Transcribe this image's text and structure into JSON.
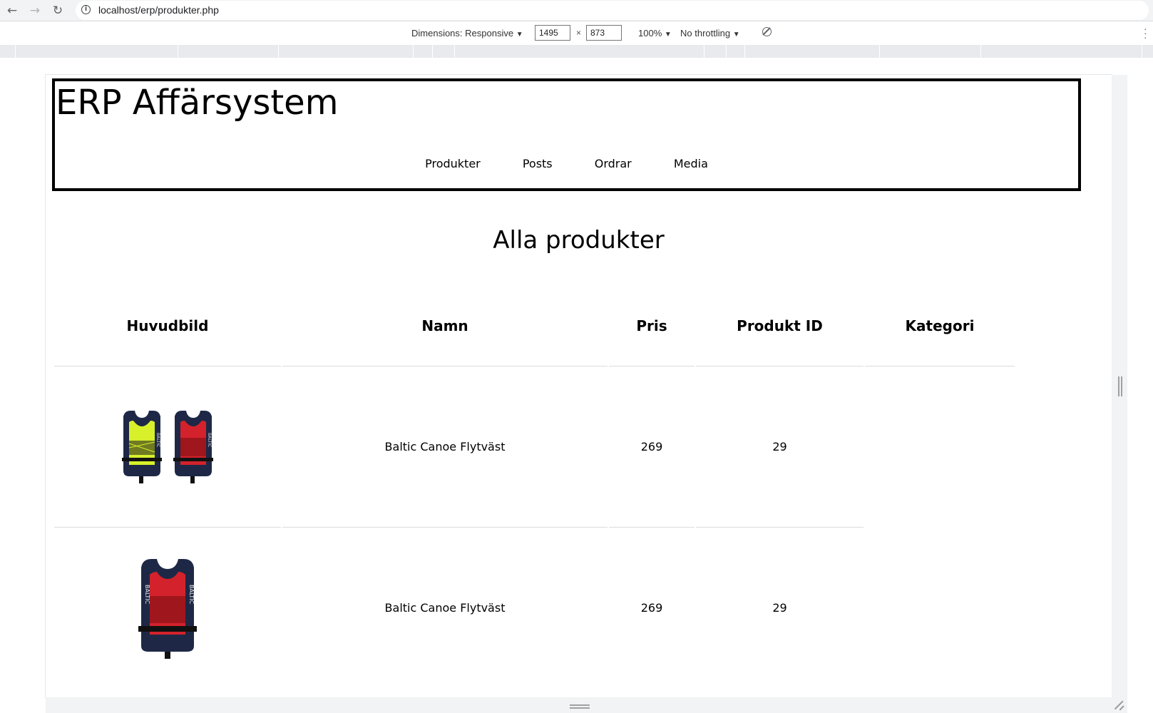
{
  "browser": {
    "url": "localhost/erp/produkter.php",
    "back_icon": "arrow-left-icon",
    "forward_icon": "arrow-right-icon",
    "reload_icon": "reload-icon"
  },
  "devtools": {
    "dimensions_label": "Dimensions: Responsive",
    "width": "1495",
    "separator": "×",
    "height": "873",
    "zoom": "100%",
    "throttling": "No throttling"
  },
  "site": {
    "title": "ERP Affärsystem",
    "nav": [
      "Produkter",
      "Posts",
      "Ordrar",
      "Media"
    ]
  },
  "main": {
    "heading": "Alla produkter",
    "table": {
      "headers": [
        "Huvudbild",
        "Namn",
        "Pris",
        "Produkt ID",
        "Kategori"
      ],
      "rows": [
        {
          "image": "two-life-vests-yellow-red",
          "name": "Baltic Canoe Flytväst",
          "price": "269",
          "id": "29",
          "category": ""
        },
        {
          "image": "life-vest-red",
          "name": "Baltic Canoe Flytväst",
          "price": "269",
          "id": "29",
          "category": ""
        }
      ]
    }
  },
  "colors": {
    "vest_yellow": "#d7f02a",
    "vest_red": "#d3222b",
    "vest_navy": "#1e2846"
  }
}
